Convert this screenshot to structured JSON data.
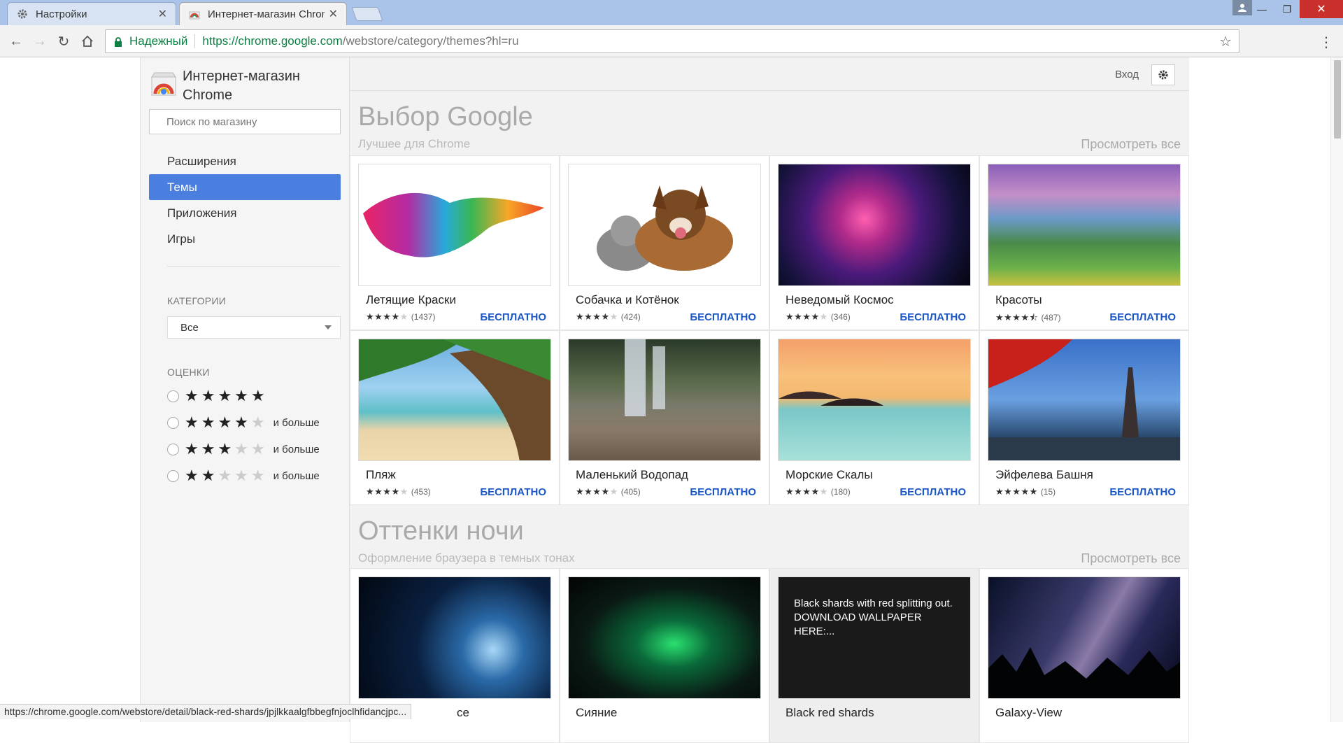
{
  "tabs": [
    {
      "title": "Настройки",
      "icon": "gear-icon",
      "active": false
    },
    {
      "title": "Интернет-магазин Chrome",
      "icon": "chrome-store-icon",
      "active": true
    }
  ],
  "omnibox": {
    "secure_label": "Надежный",
    "url_host": "https://chrome.google.com",
    "url_path": "/webstore/category/themes?hl=ru"
  },
  "sidebar": {
    "store_title_line1": "Интернет-магазин",
    "store_title_line2": "Chrome",
    "search_placeholder": "Поиск по магазину",
    "nav": [
      {
        "label": "Расширения",
        "selected": false
      },
      {
        "label": "Темы",
        "selected": true
      },
      {
        "label": "Приложения",
        "selected": false
      },
      {
        "label": "Игры",
        "selected": false
      }
    ],
    "categories_label": "КАТЕГОРИИ",
    "category_value": "Все",
    "ratings_label": "ОЦЕНКИ",
    "rating_more": "и больше"
  },
  "main": {
    "login": "Вход",
    "sections": [
      {
        "title": "Выбор Google",
        "subtitle": "Лучшее для Chrome",
        "view_all": "Просмотреть все",
        "cards": [
          {
            "title": "Летящие Краски",
            "rating": 4,
            "count": "(1437)",
            "price": "БЕСПЛАТНО"
          },
          {
            "title": "Собачка и Котёнок",
            "rating": 4,
            "count": "(424)",
            "price": "БЕСПЛАТНО"
          },
          {
            "title": "Неведомый Космос",
            "rating": 4,
            "count": "(346)",
            "price": "БЕСПЛАТНО"
          },
          {
            "title": "Красоты",
            "rating": 4.5,
            "count": "(487)",
            "price": "БЕСПЛАТНО"
          },
          {
            "title": "Пляж",
            "rating": 4,
            "count": "(453)",
            "price": "БЕСПЛАТНО"
          },
          {
            "title": "Маленький Водопад",
            "rating": 4,
            "count": "(405)",
            "price": "БЕСПЛАТНО"
          },
          {
            "title": "Морские Скалы",
            "rating": 4,
            "count": "(180)",
            "price": "БЕСПЛАТНО"
          },
          {
            "title": "Эйфелева Башня",
            "rating": 5,
            "count": "(15)",
            "price": "БЕСПЛАТНО"
          }
        ]
      },
      {
        "title": "Оттенки ночи",
        "subtitle": "Оформление браузера в темных тонах",
        "view_all": "Просмотреть все",
        "cards": [
          {
            "title": "ce"
          },
          {
            "title": "Сияние"
          },
          {
            "title": "Black red shards",
            "overlay": "Black shards with red splitting out. DOWNLOAD WALLPAPER HERE:..."
          },
          {
            "title": "Galaxy-View"
          }
        ]
      }
    ]
  },
  "status_url": "https://chrome.google.com/webstore/detail/black-red-shards/jpjlkkaalgfbbegfnjoclhfidancjpc...",
  "colors": {
    "accent": "#4a7fdf",
    "price": "#1a57c4",
    "secure": "#0b8043"
  }
}
